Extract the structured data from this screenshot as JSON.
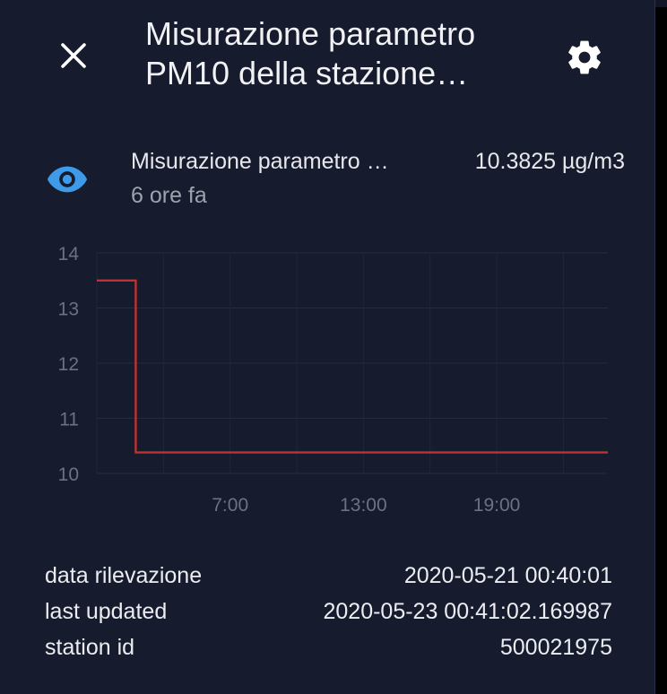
{
  "dialog": {
    "title_line1": "Misurazione parametro",
    "title_line2": "PM10 della stazione…",
    "close_icon": "close-icon",
    "settings_icon": "gear-icon"
  },
  "entity": {
    "icon": "eye-icon",
    "icon_color": "#3d9be9",
    "name": "Misurazione parametro …",
    "last_changed": "6 ore fa",
    "value": "10.3825 µg/m3"
  },
  "chart_data": {
    "type": "line",
    "step": true,
    "y_ticks": [
      "14",
      "13",
      "12",
      "11",
      "10"
    ],
    "x_ticks": [
      "7:00",
      "13:00",
      "19:00"
    ],
    "ylim": [
      10,
      14
    ],
    "xlim": [
      "1:00",
      "24:00"
    ],
    "grid": true,
    "series": [
      {
        "color": "#c0322d",
        "x": [
          "1:00",
          "2:45",
          "2:45",
          "24:00"
        ],
        "values": [
          13.5,
          13.5,
          10.38,
          10.38
        ]
      }
    ]
  },
  "attributes": [
    {
      "key": "data rilevazione",
      "value": "2020-05-21 00:40:01"
    },
    {
      "key": "last updated",
      "value": "2020-05-23 00:41:02.169987"
    },
    {
      "key": "station id",
      "value": "500021975"
    }
  ]
}
